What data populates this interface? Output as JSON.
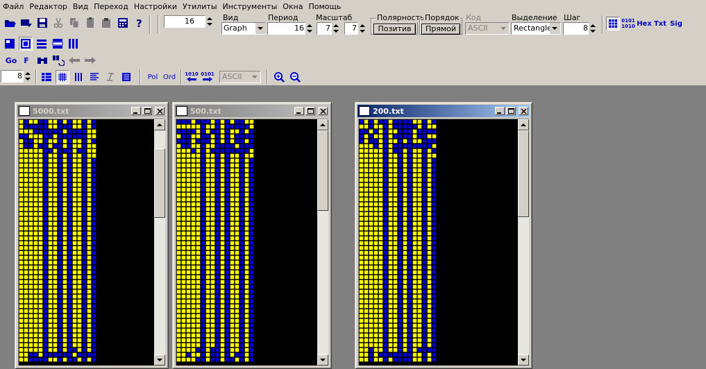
{
  "menu": [
    "Файл",
    "Редактор",
    "Вид",
    "Переход",
    "Настройки",
    "Утилиты",
    "Инструменты",
    "Окна",
    "Помощь"
  ],
  "toolbar": {
    "width_value": "16",
    "view_label": "Вид",
    "view_value": "Graph",
    "period_label": "Период",
    "period_value": "16",
    "scale_label": "Масштаб",
    "scale_x": "7",
    "scale_y": "7",
    "polarity_label": "Полярность",
    "polarity_button": "Позитив",
    "order_label": "Порядок",
    "order_button": "Прямой",
    "code_label": "Код",
    "code_value": "ASCII",
    "selection_label": "Выделение",
    "selection_value": "Rectangle",
    "step_label": "Шаг",
    "step_value": "8",
    "fmt_bin_top": "0101",
    "fmt_bin_bot": "1010",
    "fmt_hex": "Hex",
    "fmt_txt": "Txt",
    "fmt_sig": "Sig",
    "go_label": "Go",
    "f_label": "F",
    "bits_value": "8",
    "pol_label": "Pol",
    "ord_label": "Ord",
    "bin_top": "1010",
    "bin_bot": "0101",
    "encoding_value": "ASCII"
  },
  "colors": {
    "face": "#d4d0c8",
    "bit_one": "#ffff00",
    "bit_zero": "#0000cc",
    "grid": "#000000",
    "active_title": "#0a246a",
    "inactive_title": "#808080"
  },
  "windows": [
    {
      "title": "5000.txt",
      "active": false
    },
    {
      "title": "500.txt",
      "active": false
    },
    {
      "title": "200.txt",
      "active": true
    }
  ]
}
